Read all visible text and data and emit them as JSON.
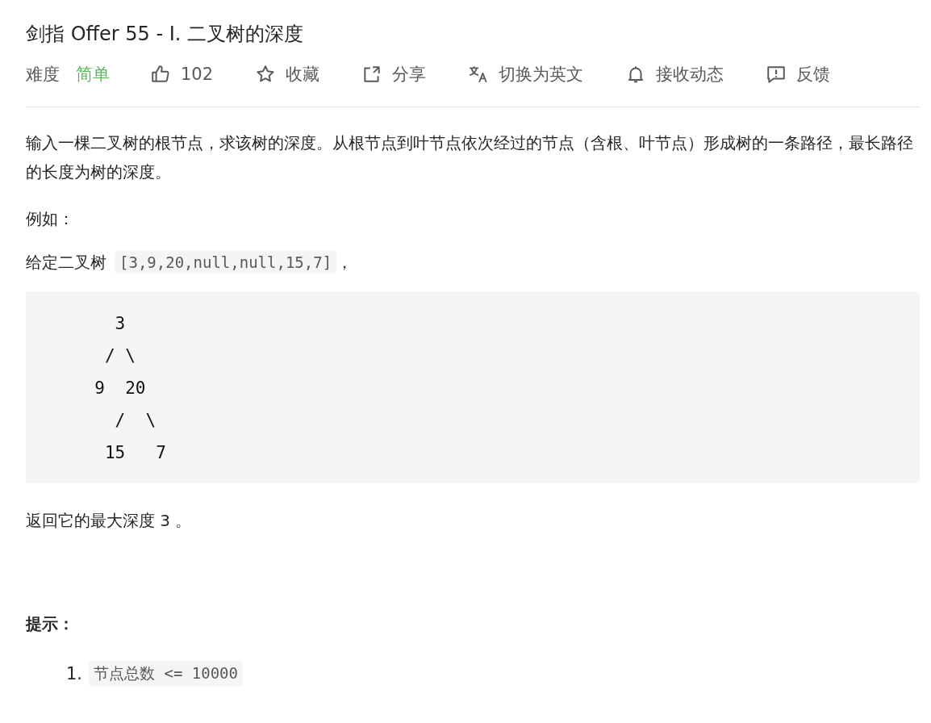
{
  "title": "剑指 Offer 55 - I. 二叉树的深度",
  "toolbar": {
    "difficulty_label": "难度",
    "difficulty": "简单",
    "actions": [
      {
        "kind": "like",
        "label": "102"
      },
      {
        "kind": "star",
        "label": "收藏"
      },
      {
        "kind": "share",
        "label": "分享"
      },
      {
        "kind": "translate",
        "label": "切换为英文"
      },
      {
        "kind": "bell",
        "label": "接收动态"
      },
      {
        "kind": "feedback",
        "label": "反馈"
      }
    ]
  },
  "description": "输入一棵二叉树的根节点，求该树的深度。从根节点到叶节点依次经过的节点（含根、叶节点）形成树的一条路径，最长路径的长度为树的深度。",
  "example_label": "例如：",
  "given": {
    "before": "给定二叉树",
    "code": "[3,9,20,null,null,15,7]",
    "after": "，"
  },
  "code_block": "    3\n   / \\\n  9  20\n    /  \\\n   15   7",
  "return_text": "返回它的最大深度 3 。",
  "hints_title": "提示：",
  "hints": [
    {
      "marker": "1.",
      "code": "节点总数 <= 10000"
    }
  ]
}
